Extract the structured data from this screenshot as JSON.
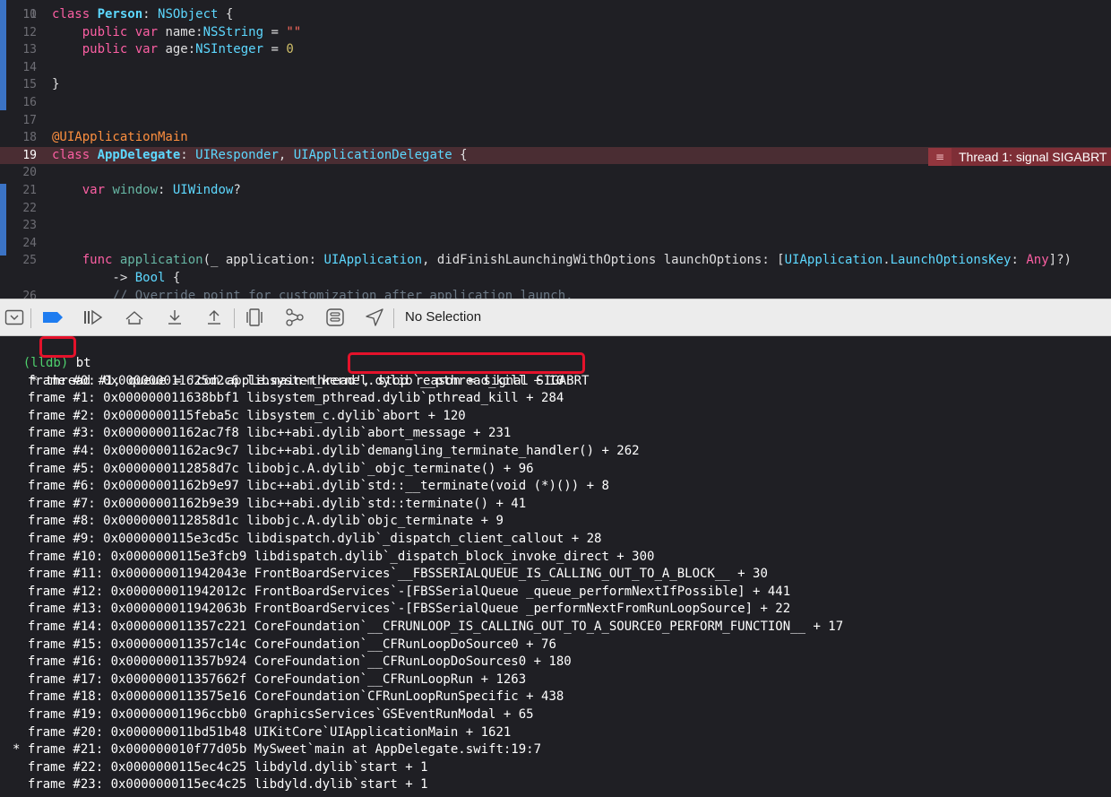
{
  "editor": {
    "partial_top_line_number": "10",
    "lines": [
      {
        "n": "11",
        "tokens": [
          [
            "kw",
            "class "
          ],
          [
            "dc",
            "Person"
          ],
          [
            "pl",
            ": "
          ],
          [
            "ty",
            "NSObject"
          ],
          [
            "pl",
            " {"
          ]
        ]
      },
      {
        "n": "12",
        "tokens": [
          [
            "pl",
            "    "
          ],
          [
            "kw",
            "public var "
          ],
          [
            "pl",
            "name:"
          ],
          [
            "ty",
            "NSString"
          ],
          [
            "pl",
            " = "
          ],
          [
            "st",
            "\"\""
          ]
        ]
      },
      {
        "n": "13",
        "tokens": [
          [
            "pl",
            "    "
          ],
          [
            "kw",
            "public var "
          ],
          [
            "pl",
            "age:"
          ],
          [
            "ty",
            "NSInteger"
          ],
          [
            "pl",
            " = "
          ],
          [
            "nu",
            "0"
          ]
        ]
      },
      {
        "n": "14",
        "tokens": []
      },
      {
        "n": "15",
        "tokens": [
          [
            "pl",
            "}"
          ]
        ]
      },
      {
        "n": "16",
        "tokens": []
      },
      {
        "n": "17",
        "tokens": []
      },
      {
        "n": "18",
        "tokens": [
          [
            "at",
            "@UIApplicationMain"
          ]
        ]
      },
      {
        "n": "19",
        "tokens": [
          [
            "kw",
            "class "
          ],
          [
            "dc",
            "AppDelegate"
          ],
          [
            "pl",
            ": "
          ],
          [
            "ty",
            "UIResponder"
          ],
          [
            "pl",
            ", "
          ],
          [
            "ty",
            "UIApplicationDelegate"
          ],
          [
            "pl",
            " {"
          ]
        ]
      },
      {
        "n": "20",
        "tokens": []
      },
      {
        "n": "21",
        "tokens": [
          [
            "pl",
            "    "
          ],
          [
            "kw",
            "var "
          ],
          [
            "fn",
            "window"
          ],
          [
            "pl",
            ": "
          ],
          [
            "ty",
            "UIWindow"
          ],
          [
            "pl",
            "?"
          ]
        ]
      },
      {
        "n": "22",
        "tokens": []
      },
      {
        "n": "23",
        "tokens": []
      },
      {
        "n": "24",
        "tokens": []
      },
      {
        "n": "25",
        "tokens": [
          [
            "pl",
            "    "
          ],
          [
            "kw",
            "func "
          ],
          [
            "fn",
            "application"
          ],
          [
            "pl",
            "(_ application: "
          ],
          [
            "ty",
            "UIApplication"
          ],
          [
            "pl",
            ", didFinishLaunchingWithOptions launchOptions: ["
          ],
          [
            "ty",
            "UIApplication"
          ],
          [
            "pl",
            "."
          ],
          [
            "ty",
            "LaunchOptionsKey"
          ],
          [
            "pl",
            ": "
          ],
          [
            "kw",
            "Any"
          ],
          [
            "pl",
            "]?)"
          ]
        ]
      },
      {
        "n": "",
        "tokens": [
          [
            "pl",
            "        -> "
          ],
          [
            "ty",
            "Bool"
          ],
          [
            "pl",
            " {"
          ]
        ]
      },
      {
        "n": "26",
        "tokens": [
          [
            "cm",
            "        // Override point for customization after application launch."
          ]
        ]
      }
    ],
    "highlighted_line": "19",
    "error_annotation": {
      "text": "Thread 1: signal SIGABRT",
      "icon": "error-lines-icon"
    }
  },
  "debug_bar": {
    "buttons": [
      "hide-debug-area-icon",
      "breakpoints-toggle-icon",
      "continue-icon",
      "step-over-icon",
      "step-into-icon",
      "step-out-icon",
      "debug-view-hierarchy-icon",
      "memory-graph-icon",
      "environment-overrides-icon",
      "simulate-location-icon"
    ],
    "no_selection_label": "No Selection"
  },
  "console": {
    "prompt": "(lldb)",
    "command": "bt",
    "thread_prefix": "* thread #1, queue = 'com.apple.main-thread', ",
    "stop_reason": "stop reason = signal SIGABRT",
    "frames": [
      "  frame #0: 0x000000011625d2c6 libsystem_kernel.dylib`__pthread_kill + 10",
      "  frame #1: 0x000000011638bbf1 libsystem_pthread.dylib`pthread_kill + 284",
      "  frame #2: 0x0000000115feba5c libsystem_c.dylib`abort + 120",
      "  frame #3: 0x00000001162ac7f8 libc++abi.dylib`abort_message + 231",
      "  frame #4: 0x00000001162ac9c7 libc++abi.dylib`demangling_terminate_handler() + 262",
      "  frame #5: 0x0000000112858d7c libobjc.A.dylib`_objc_terminate() + 96",
      "  frame #6: 0x00000001162b9e97 libc++abi.dylib`std::__terminate(void (*)()) + 8",
      "  frame #7: 0x00000001162b9e39 libc++abi.dylib`std::terminate() + 41",
      "  frame #8: 0x0000000112858d1c libobjc.A.dylib`objc_terminate + 9",
      "  frame #9: 0x0000000115e3cd5c libdispatch.dylib`_dispatch_client_callout + 28",
      "  frame #10: 0x0000000115e3fcb9 libdispatch.dylib`_dispatch_block_invoke_direct + 300",
      "  frame #11: 0x000000011942043e FrontBoardServices`__FBSSERIALQUEUE_IS_CALLING_OUT_TO_A_BLOCK__ + 30",
      "  frame #12: 0x000000011942012c FrontBoardServices`-[FBSSerialQueue _queue_performNextIfPossible] + 441",
      "  frame #13: 0x000000011942063b FrontBoardServices`-[FBSSerialQueue _performNextFromRunLoopSource] + 22",
      "  frame #14: 0x000000011357c221 CoreFoundation`__CFRUNLOOP_IS_CALLING_OUT_TO_A_SOURCE0_PERFORM_FUNCTION__ + 17",
      "  frame #15: 0x000000011357c14c CoreFoundation`__CFRunLoopDoSource0 + 76",
      "  frame #16: 0x000000011357b924 CoreFoundation`__CFRunLoopDoSources0 + 180",
      "  frame #17: 0x000000011357662f CoreFoundation`__CFRunLoopRun + 1263",
      "  frame #18: 0x0000000113575e16 CoreFoundation`CFRunLoopRunSpecific + 438",
      "  frame #19: 0x00000001196ccbb0 GraphicsServices`GSEventRunModal + 65",
      "  frame #20: 0x000000011bd51b48 UIKitCore`UIApplicationMain + 1621",
      "* frame #21: 0x000000010f77d05b MySweet`main at AppDelegate.swift:19:7",
      "  frame #22: 0x0000000115ec4c25 libdyld.dylib`start + 1",
      "  frame #23: 0x0000000115ec4c25 libdyld.dylib`start + 1"
    ]
  },
  "colors": {
    "highlight_line": "#4a2d33",
    "error_red": "#7e2e36",
    "annotation_box": "#e4122b",
    "prompt_green": "#4ed06d"
  }
}
